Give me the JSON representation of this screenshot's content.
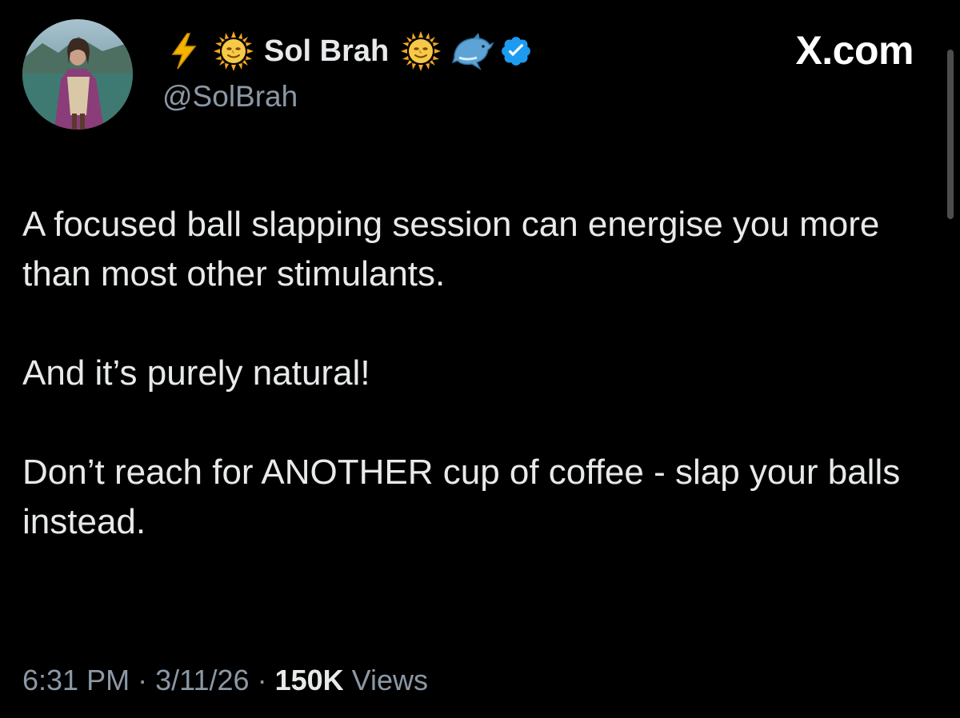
{
  "header": {
    "display_name": "Sol Brah",
    "handle": "@SolBrah",
    "icons": [
      "lightning-icon",
      "sun-icon",
      "sun-icon",
      "dolphin-icon",
      "verified-badge-icon"
    ]
  },
  "brand": {
    "label": "X.com"
  },
  "tweet": {
    "paragraphs": [
      "A focused ball slapping session can energise you more than most other stimulants.",
      "And it’s purely natural!",
      "Don’t reach for ANOTHER cup of coffee - slap your balls instead."
    ]
  },
  "meta": {
    "time": "6:31 PM",
    "separator": "·",
    "date": "3/11/26",
    "views_count": "150K",
    "views_label": "Views"
  },
  "colors": {
    "background": "#000000",
    "text_primary": "#e7e9ea",
    "text_secondary": "#8b98a5",
    "verified_blue": "#1d9bf0",
    "lightning": "#f4b400",
    "sun": "#f7b928"
  }
}
